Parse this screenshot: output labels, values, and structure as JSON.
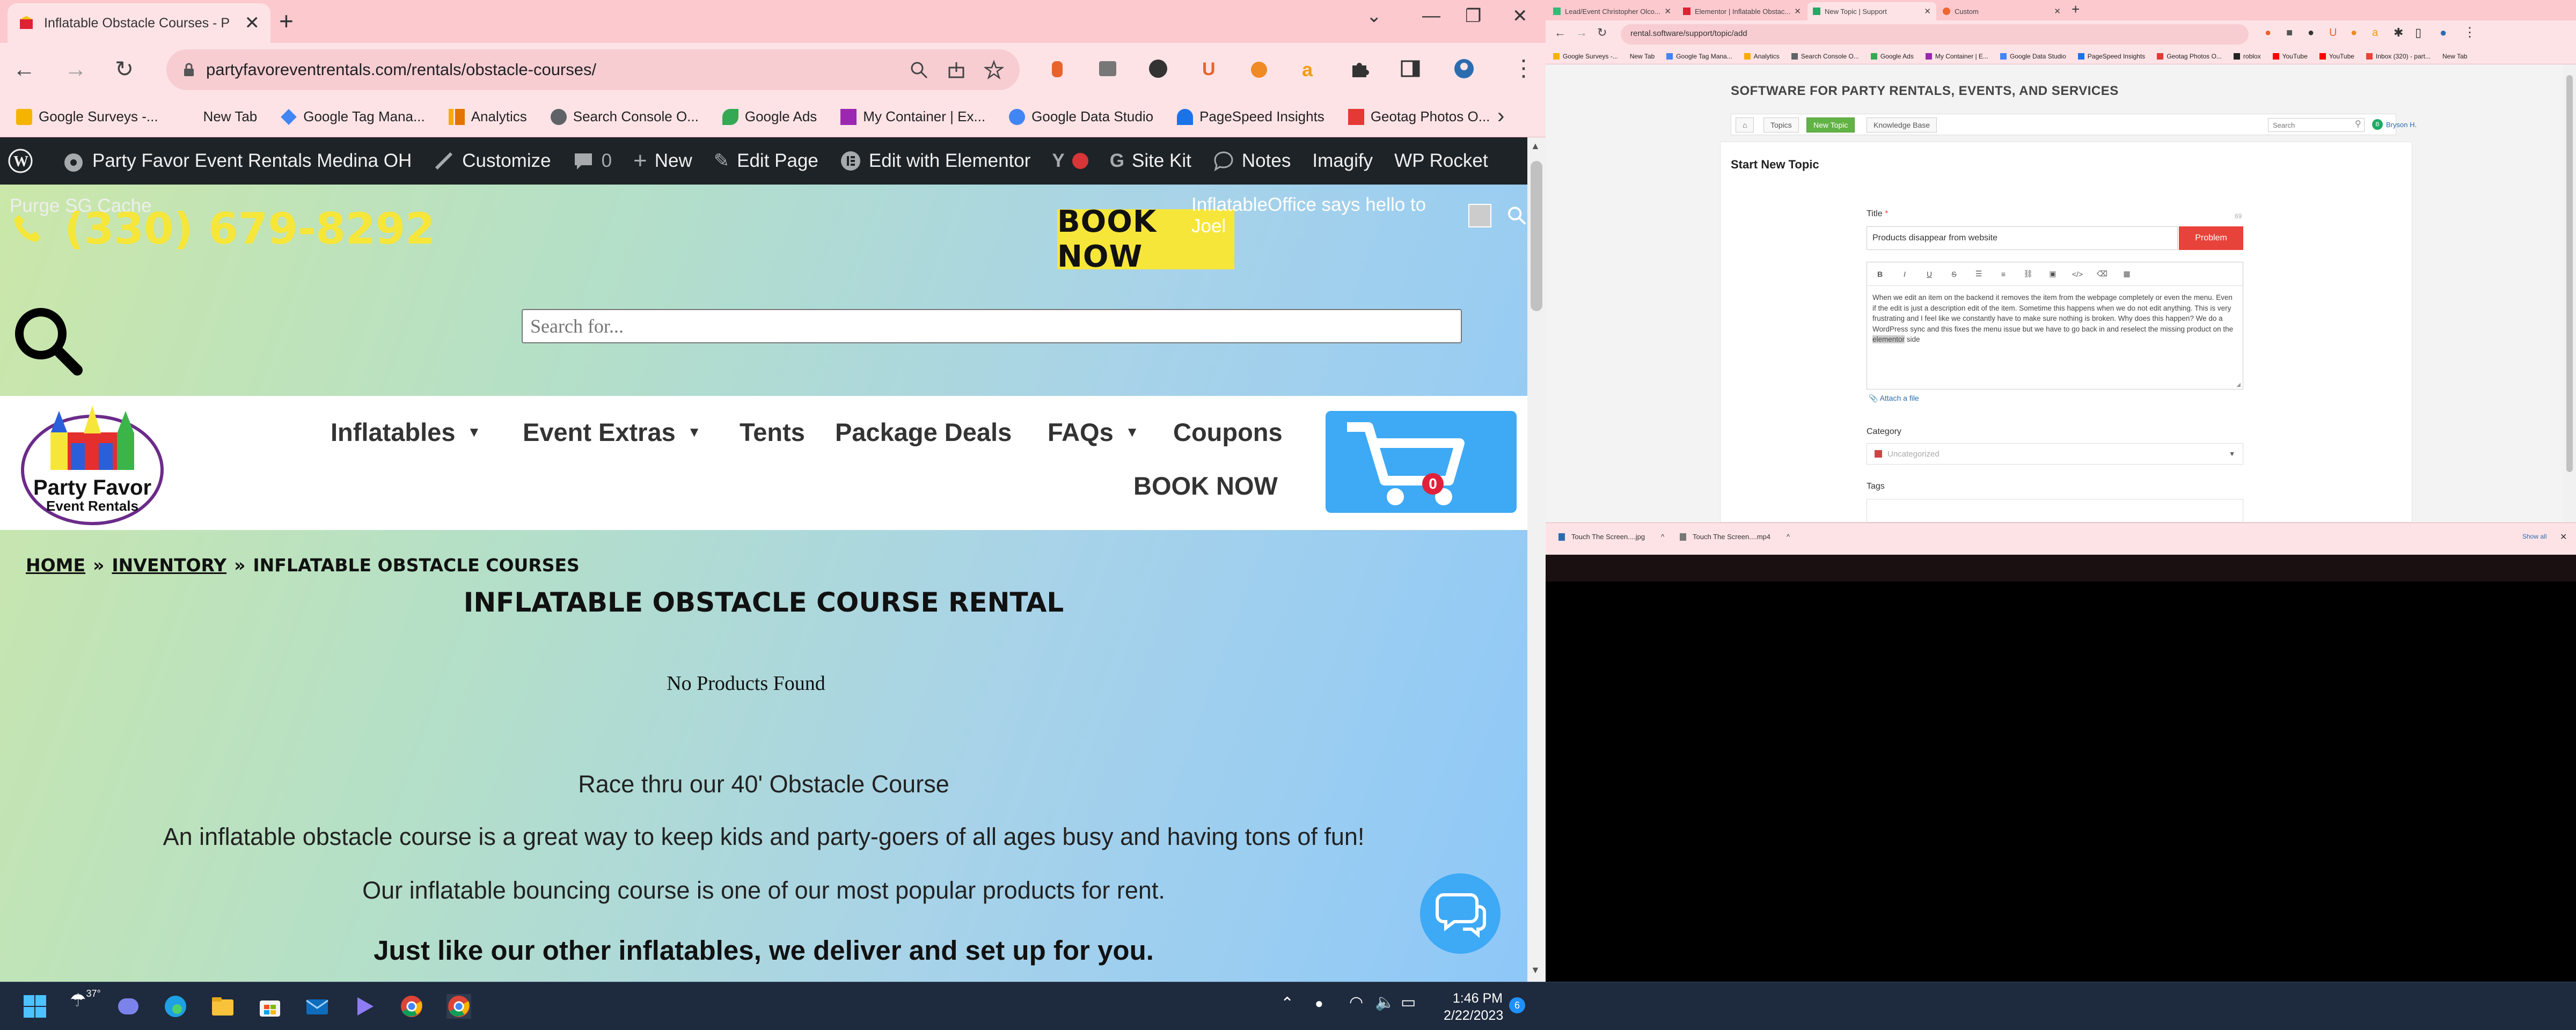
{
  "left_browser": {
    "tab_title": "Inflatable Obstacle Courses - P",
    "url": "partyfavoreventrentals.com/rentals/obstacle-courses/",
    "bookmarks": [
      {
        "label": "Google Surveys -...",
        "color": "#f4b400"
      },
      {
        "label": "New Tab",
        "color": ""
      },
      {
        "label": "Google Tag Mana...",
        "color": "#4285f4"
      },
      {
        "label": "Analytics",
        "color": "#f9ab00"
      },
      {
        "label": "Search Console O...",
        "color": "#5f6368"
      },
      {
        "label": "Google Ads",
        "color": "#34a853"
      },
      {
        "label": "My Container | Ex...",
        "color": "#9c27b0"
      },
      {
        "label": "Google Data Studio",
        "color": "#4285f4"
      },
      {
        "label": "PageSpeed Insights",
        "color": "#1a73e8"
      },
      {
        "label": "Geotag Photos O...",
        "color": "#e53935"
      }
    ]
  },
  "wp_admin_bar": {
    "site_name": "Party Favor Event Rentals Medina OH",
    "customize": "Customize",
    "comments_count": "0",
    "new": "New",
    "edit_page": "Edit Page",
    "edit_elementor": "Edit with Elementor",
    "site_kit": "Site Kit",
    "notes": "Notes",
    "imagify": "Imagify",
    "wp_rocket": "WP Rocket"
  },
  "site": {
    "purge": "Purge SG Cache",
    "phone": "(330) 679-8292",
    "book_now_top": "BOOK NOW",
    "hello_text": "InflatableOffice says hello to Joel",
    "search_placeholder": "Search for...",
    "logo_line1": "Party Favor",
    "logo_line2": "Event Rentals",
    "nav": {
      "inflatables": "Inflatables",
      "event_extras": "Event Extras",
      "tents": "Tents",
      "package_deals": "Package Deals",
      "faqs": "FAQs",
      "coupons": "Coupons",
      "book_now": "BOOK NOW"
    },
    "cart_count": "0",
    "breadcrumb": {
      "home": "HOME",
      "inventory": "INVENTORY",
      "current": "INFLATABLE OBSTACLE COURSES",
      "sep": "»"
    },
    "page_title": "INFLATABLE OBSTACLE COURSE RENTAL",
    "no_products": "No Products Found",
    "paragraphs": [
      "Race thru our 40' Obstacle Course",
      "An inflatable obstacle course is a great way to keep kids and party-goers of all ages busy and having tons of fun!",
      "Our inflatable bouncing course is one of our most popular products for rent."
    ],
    "bold_line": "Just like our other inflatables, we deliver and set up for you."
  },
  "right_browser": {
    "tabs": [
      "Lead/Event Christopher Olco...",
      "Elementor | Inflatable Obstac...",
      "New Topic | Support",
      "Custom"
    ],
    "url": "rental.software/support/topic/add",
    "bookmarks": [
      "Google Surveys -...",
      "New Tab",
      "Google Tag Mana...",
      "Analytics",
      "Search Console O...",
      "Google Ads",
      "My Container | E...",
      "Google Data Studio",
      "PageSpeed Insights",
      "Geotag Photos O...",
      "roblox",
      "YouTube",
      "YouTube",
      "Inbox (320) - part...",
      "New Tab"
    ],
    "site_title": "SOFTWARE FOR PARTY RENTALS, EVENTS, AND SERVICES",
    "nav": {
      "topics": "Topics",
      "new_topic": "New Topic",
      "knowledge_base": "Knowledge Base",
      "search_placeholder": "Search",
      "user": "Bryson H.",
      "user_initial": "B"
    },
    "heading": "Start New Topic",
    "title_label": "Title",
    "required_mark": "*",
    "char_count": "69",
    "title_value": "Products disappear from website",
    "type_button": "Problem",
    "body_text_before": "When we edit an item on the backend it removes the item from the webpage completely or even the menu. Even if the edit is just a description edit of the item. Sometime this happens when we do not edit anything. This is very frustrating and I feel like we constantly have to make sure nothing is broken. Why does this happen? We do a WordPress sync and this fixes the menu issue but we have to go back in and reselect the missing product on the ",
    "body_highlight": "elementor",
    "body_text_after": " side",
    "attach": "Attach a file",
    "category_label": "Category",
    "category_value": "Uncategorized",
    "tags_label": "Tags",
    "downloads": [
      "Touch The Screen....jpg",
      "Touch The Screen....mp4"
    ],
    "show_all": "Show all"
  },
  "taskbar": {
    "weather": "37°",
    "time": "1:46 PM",
    "date": "2/22/2023",
    "notifications": "6"
  }
}
